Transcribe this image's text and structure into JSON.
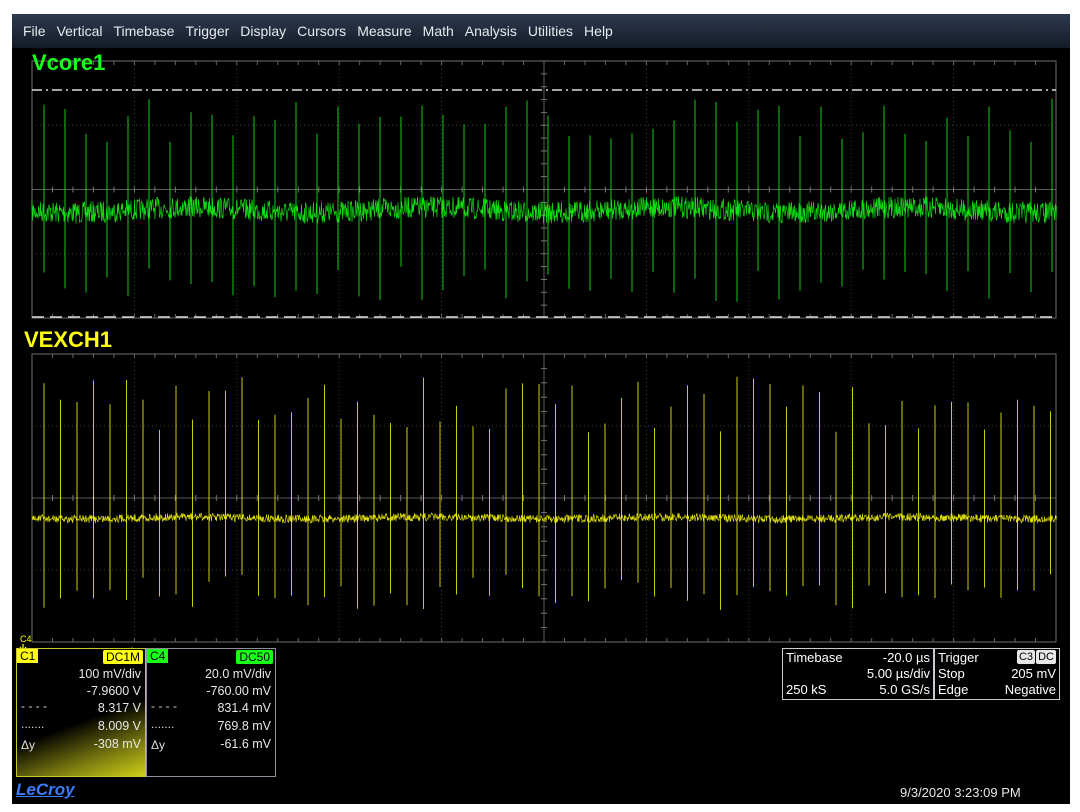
{
  "menu": [
    "File",
    "Vertical",
    "Timebase",
    "Trigger",
    "Display",
    "Cursors",
    "Measure",
    "Math",
    "Analysis",
    "Utilities",
    "Help"
  ],
  "traces": {
    "c1": {
      "label": "Vcore1",
      "color": "#18ff18"
    },
    "c4": {
      "label": "VEXCH1",
      "color": "#ffff10"
    }
  },
  "c4_marker": "C4",
  "channel1": {
    "name": "C1",
    "coupling": "DC1M",
    "vdiv": "100 mV/div",
    "offset": "-7.9600 V",
    "cursor1": "8.317 V",
    "cursor2": "8.009 V",
    "delta_label": "Δy",
    "delta": "-308 mV"
  },
  "channel4": {
    "name": "C4",
    "coupling": "DC50",
    "vdiv": "20.0 mV/div",
    "offset": "-760.00 mV",
    "cursor1": "831.4 mV",
    "cursor2": "769.8 mV",
    "delta_label": "Δy",
    "delta": "-61.6 mV"
  },
  "timebase": {
    "label": "Timebase",
    "delay": "-20.0 µs",
    "tdiv": "5.00 µs/div",
    "samples": "250 kS",
    "rate": "5.0 GS/s"
  },
  "trigger": {
    "label": "Trigger",
    "source": "C3",
    "coupling": "DC",
    "mode": "Stop",
    "level": "205 mV",
    "type": "Edge",
    "slope": "Negative"
  },
  "brand": "LeCroy",
  "datetime": "9/3/2020 3:23:09 PM"
}
